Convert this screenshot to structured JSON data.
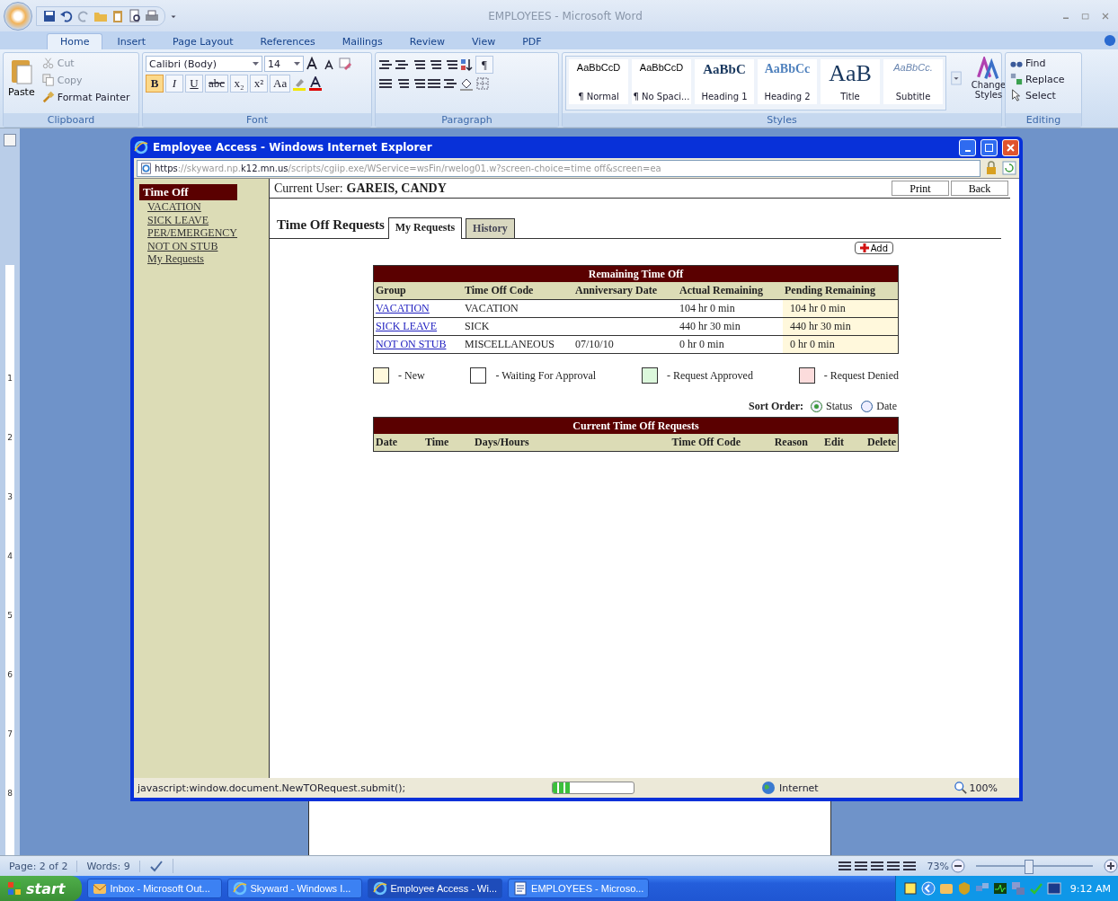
{
  "word": {
    "title": "EMPLOYEES - Microsoft Word",
    "tabs": [
      {
        "label": "Home",
        "selected": true
      },
      {
        "label": "Insert",
        "selected": false
      },
      {
        "label": "Page Layout",
        "selected": false
      },
      {
        "label": "References",
        "selected": false
      },
      {
        "label": "Mailings",
        "selected": false
      },
      {
        "label": "Review",
        "selected": false
      },
      {
        "label": "View",
        "selected": false
      },
      {
        "label": "PDF",
        "selected": false
      }
    ],
    "clipboard": {
      "paste": "Paste",
      "cut": "Cut",
      "copy": "Copy",
      "format_painter": "Format Painter",
      "label": "Clipboard"
    },
    "font": {
      "name": "Calibri (Body)",
      "size": "14",
      "buttons": [
        {
          "label": "B",
          "kind": "bold",
          "selected": true
        },
        {
          "label": "I",
          "kind": "italic",
          "selected": false
        },
        {
          "label": "U",
          "kind": "underline",
          "selected": false
        },
        {
          "label": "abc",
          "kind": "strike",
          "selected": false
        },
        {
          "label": "x₂",
          "kind": "plain",
          "selected": false
        },
        {
          "label": "x²",
          "kind": "plain",
          "selected": false
        },
        {
          "label": "Aa",
          "kind": "plain",
          "selected": false
        }
      ],
      "label": "Font"
    },
    "paragraph": {
      "pilcrow": "¶",
      "label": "Paragraph"
    },
    "styles": {
      "items": [
        {
          "preview": "AaBbCcD",
          "name": "¶ Normal",
          "kind": "normal"
        },
        {
          "preview": "AaBbCcD",
          "name": "¶ No Spaci...",
          "kind": "normal"
        },
        {
          "preview": "AaBbC",
          "name": "Heading 1",
          "kind": "heading1"
        },
        {
          "preview": "AaBbCc",
          "name": "Heading 2",
          "kind": "heading2"
        },
        {
          "preview": "AaB",
          "name": "Title",
          "kind": "title"
        },
        {
          "preview": "AaBbCc.",
          "name": "Subtitle",
          "kind": "subtitle"
        }
      ],
      "change": "Change Styles",
      "label": "Styles"
    },
    "editing": {
      "find": "Find",
      "replace": "Replace",
      "select": "Select",
      "label": "Editing"
    },
    "ruler_numbers": [
      "1",
      "2",
      "3",
      "4",
      "5",
      "6",
      "7",
      "8"
    ],
    "status": {
      "page": "Page: 2 of 2",
      "words": "Words: 9",
      "zoom": "73%",
      "zoom_slider": {
        "level": 0.45
      }
    }
  },
  "browser": {
    "title": "Employee Access - Windows Internet Explorer",
    "address": [
      {
        "text": "https",
        "dim": false
      },
      {
        "text": "://skyward.np.",
        "dim": true
      },
      {
        "text": "k12.mn.us",
        "dim": false
      },
      {
        "text": "/scripts/cgiip.exe/WService=wsFin/rwelog01.w?screen-choice=time off&screen=ea",
        "dim": true
      }
    ],
    "sidebar": {
      "header": "Time Off",
      "links": [
        "VACATION",
        "SICK LEAVE",
        "PER/EMERGENCY",
        "NOT ON STUB",
        "My Requests"
      ]
    },
    "user_label": "Current User:",
    "user_name": "GAREIS, CANDY",
    "buttons": [
      "Print",
      "Back"
    ],
    "heading": "Time Off Requests",
    "tabs": [
      {
        "label": "My Requests",
        "selected": true
      },
      {
        "label": "History",
        "selected": false
      }
    ],
    "add_button": "Add",
    "remaining": {
      "title": "Remaining Time Off",
      "columns": [
        "Group",
        "Time Off Code",
        "Anniversary Date",
        "Actual Remaining",
        "Pending Remaining"
      ],
      "rows": [
        [
          "VACATION",
          "VACATION",
          "",
          "104 hr 0 min",
          "104 hr 0 min"
        ],
        [
          "SICK LEAVE",
          "SICK",
          "",
          "440 hr 30 min",
          "440 hr 30 min"
        ],
        [
          "NOT ON STUB",
          "MISCELLANEOUS",
          "07/10/10",
          "0 hr 0 min",
          "0 hr 0 min"
        ]
      ]
    },
    "legend": [
      {
        "label": "- New",
        "color": "#fff8dc"
      },
      {
        "label": "- Waiting For Approval",
        "color": "#ffffff"
      },
      {
        "label": "- Request Approved",
        "color": "#dcf8dc"
      },
      {
        "label": "- Request Denied",
        "color": "#fcdcdc"
      }
    ],
    "sort": {
      "label": "Sort Order:",
      "options": [
        {
          "label": "Status",
          "selected": true
        },
        {
          "label": "Date",
          "selected": false
        }
      ]
    },
    "current": {
      "title": "Current Time Off Requests",
      "columns": [
        "Date",
        "Time",
        "Days/Hours",
        "Time Off Code",
        "Reason",
        "Edit",
        "Delete"
      ]
    },
    "status": {
      "text": "javascript:window.document.NewTORequest.submit();",
      "progress": {
        "level": 0.22
      },
      "zone": "Internet",
      "zoom": "100%"
    }
  },
  "taskbar": {
    "start": "start",
    "tasks": [
      {
        "label": "Inbox - Microsoft Out...",
        "kind": "mail",
        "selected": false
      },
      {
        "label": "Skyward - Windows I...",
        "kind": "browser",
        "selected": false
      },
      {
        "label": "Employee Access - Wi...",
        "kind": "browser",
        "selected": true
      },
      {
        "label": "EMPLOYEES - Microso...",
        "kind": "document",
        "selected": false
      }
    ],
    "clock": "9:12 AM"
  }
}
